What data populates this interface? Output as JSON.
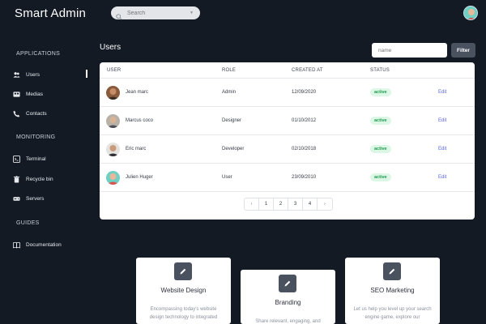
{
  "header": {
    "brand": "Smart Admin",
    "search_placeholder": "Search"
  },
  "sidebar": {
    "sections": [
      {
        "title": "APPLICATIONS",
        "items": [
          {
            "label": "Users",
            "icon": "users-icon",
            "active": true
          },
          {
            "label": "Medias",
            "icon": "media-icon"
          },
          {
            "label": "Contacts",
            "icon": "phone-icon"
          }
        ]
      },
      {
        "title": "MONITORING",
        "items": [
          {
            "label": "Terminal",
            "icon": "terminal-icon"
          },
          {
            "label": "Recycle bin",
            "icon": "trash-icon"
          },
          {
            "label": "Servers",
            "icon": "server-icon"
          }
        ]
      },
      {
        "title": "GUIDES",
        "items": [
          {
            "label": "Documentation",
            "icon": "book-icon"
          }
        ]
      }
    ]
  },
  "users": {
    "title": "Users",
    "filter_placeholder": "name",
    "filter_button": "Filter",
    "columns": [
      "USER",
      "ROLE",
      "CREATED AT",
      "STATUS"
    ],
    "rows": [
      {
        "name": "Jean marc",
        "role": "Admin",
        "created": "12/09/2020",
        "status": "active",
        "action": "Edit"
      },
      {
        "name": "Marcus coco",
        "role": "Designer",
        "created": "01/10/2012",
        "status": "active",
        "action": "Edit"
      },
      {
        "name": "Eric marc",
        "role": "Developer",
        "created": "02/10/2018",
        "status": "active",
        "action": "Edit"
      },
      {
        "name": "Julien Huger",
        "role": "User",
        "created": "23/09/2010",
        "status": "active",
        "action": "Edit"
      }
    ],
    "pagination": {
      "prev": "‹",
      "pages": [
        "1",
        "2",
        "3",
        "4"
      ],
      "next": "›"
    }
  },
  "cards": [
    {
      "title": "Website Design",
      "desc": "Encompassing today's website design technology to integrated",
      "icon": "pencil-icon"
    },
    {
      "title": "Branding",
      "desc": "Share relevant, engaging, and",
      "icon": "pencil-icon"
    },
    {
      "title": "SEO Marketing",
      "desc": "Let us help you level up your search engine game, explore our",
      "icon": "pencil-icon"
    }
  ],
  "colors": {
    "background": "#131a24",
    "status_bg": "#dcf7e6",
    "status_text": "#1e9a4d",
    "link": "#5a67d8",
    "button": "#4a5260"
  }
}
